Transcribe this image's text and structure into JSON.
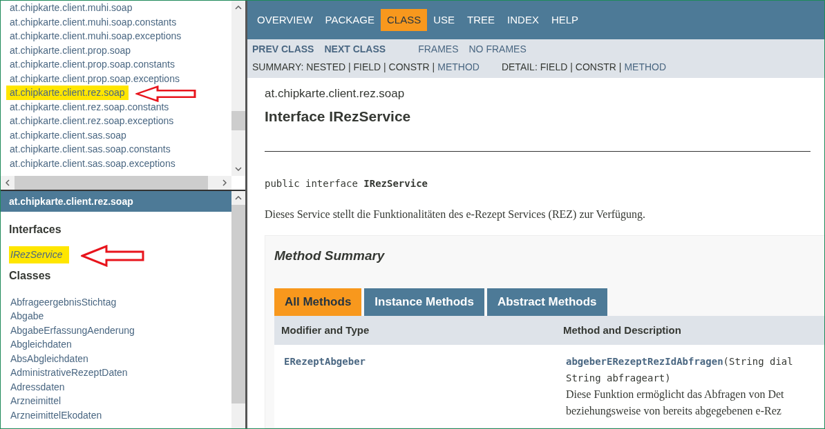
{
  "package_list": {
    "items": [
      {
        "label": "at.chipkarte.client.muhi.soap",
        "highlighted": false
      },
      {
        "label": "at.chipkarte.client.muhi.soap.constants",
        "highlighted": false
      },
      {
        "label": "at.chipkarte.client.muhi.soap.exceptions",
        "highlighted": false
      },
      {
        "label": "at.chipkarte.client.prop.soap",
        "highlighted": false
      },
      {
        "label": "at.chipkarte.client.prop.soap.constants",
        "highlighted": false
      },
      {
        "label": "at.chipkarte.client.prop.soap.exceptions",
        "highlighted": false
      },
      {
        "label": "at.chipkarte.client.rez.soap",
        "highlighted": true
      },
      {
        "label": "at.chipkarte.client.rez.soap.constants",
        "highlighted": false
      },
      {
        "label": "at.chipkarte.client.rez.soap.exceptions",
        "highlighted": false
      },
      {
        "label": "at.chipkarte.client.sas.soap",
        "highlighted": false
      },
      {
        "label": "at.chipkarte.client.sas.soap.constants",
        "highlighted": false
      },
      {
        "label": "at.chipkarte.client.sas.soap.exceptions",
        "highlighted": false
      }
    ]
  },
  "package_frame": {
    "title": "at.chipkarte.client.rez.soap",
    "sections": [
      {
        "heading": "Interfaces",
        "kind": "interface",
        "items": [
          {
            "label": "IRezService",
            "highlighted": true
          }
        ]
      },
      {
        "heading": "Classes",
        "kind": "class",
        "items": [
          {
            "label": "AbfrageergebnisStichtag",
            "highlighted": false
          },
          {
            "label": "Abgabe",
            "highlighted": false
          },
          {
            "label": "AbgabeErfassungAenderung",
            "highlighted": false
          },
          {
            "label": "Abgleichdaten",
            "highlighted": false
          },
          {
            "label": "AbsAbgleichdaten",
            "highlighted": false
          },
          {
            "label": "AdministrativeRezeptDaten",
            "highlighted": false
          },
          {
            "label": "Adressdaten",
            "highlighted": false
          },
          {
            "label": "Arzneimittel",
            "highlighted": false
          },
          {
            "label": "ArzneimittelEkodaten",
            "highlighted": false
          }
        ]
      }
    ]
  },
  "navbar": {
    "items": [
      {
        "label": "OVERVIEW",
        "selected": false
      },
      {
        "label": "PACKAGE",
        "selected": false
      },
      {
        "label": "CLASS",
        "selected": true
      },
      {
        "label": "USE",
        "selected": false
      },
      {
        "label": "TREE",
        "selected": false
      },
      {
        "label": "INDEX",
        "selected": false
      },
      {
        "label": "HELP",
        "selected": false
      }
    ]
  },
  "subnav": {
    "class_links": [
      "PREV CLASS",
      "NEXT CLASS"
    ],
    "frame_links": [
      "FRAMES",
      "NO FRAMES"
    ],
    "summary": [
      {
        "text": "SUMMARY: NESTED | FIELD | CONSTR |",
        "link": false
      },
      {
        "text": "METHOD",
        "link": true
      }
    ],
    "detail": [
      {
        "text": "DETAIL: FIELD | CONSTR |",
        "link": false
      },
      {
        "text": "METHOD",
        "link": true
      }
    ]
  },
  "content": {
    "package": "at.chipkarte.client.rez.soap",
    "title": "Interface IRezService",
    "signature": "public interface **IRezService**",
    "description": "Dieses Service stellt die Funktionalitäten des e-Rezept Services (REZ) zur Verfügung.",
    "method_summary": {
      "title": "Method Summary",
      "tabs": [
        {
          "label": "All Methods",
          "selected": true
        },
        {
          "label": "Instance Methods",
          "selected": false
        },
        {
          "label": "Abstract Methods",
          "selected": false
        }
      ],
      "columns": [
        "Modifier and Type",
        "Method and Description"
      ],
      "rows": [
        {
          "type": "ERezeptAbgeber",
          "method": "abgeberERezeptRezIdAbfragen",
          "params": [
            "(String dial",
            "String abfrageart)"
          ],
          "description": [
            "Diese Funktion ermöglicht das Abfragen von Det",
            "beziehungsweise von bereits abgegebenen e-Rez"
          ]
        }
      ]
    }
  }
}
